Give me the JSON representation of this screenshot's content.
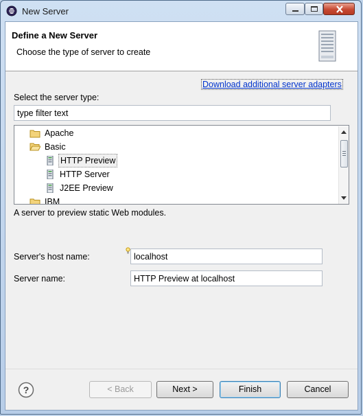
{
  "window": {
    "title": "New Server"
  },
  "header": {
    "title": "Define a New Server",
    "subtitle": "Choose the type of server to create"
  },
  "download_link": "Download additional server adapters",
  "server_type": {
    "label": "Select the server type:",
    "filter_value": "type filter text"
  },
  "tree": {
    "items": [
      {
        "label": "Apache",
        "icon": "folder-icon"
      },
      {
        "label": "Basic",
        "icon": "folder-open-icon"
      },
      {
        "label": "HTTP Preview",
        "icon": "server-icon",
        "selected": true
      },
      {
        "label": "HTTP Server",
        "icon": "server-icon"
      },
      {
        "label": "J2EE Preview",
        "icon": "server-icon"
      },
      {
        "label": "IBM",
        "icon": "folder-icon"
      }
    ]
  },
  "description": "A server to preview static Web modules.",
  "host": {
    "label": "Server's host name:",
    "value": "localhost"
  },
  "name": {
    "label": "Server name:",
    "value": "HTTP Preview at localhost"
  },
  "buttons": {
    "back": "< Back",
    "next": "Next >",
    "finish": "Finish",
    "cancel": "Cancel"
  },
  "colors": {
    "link": "#0033cc",
    "selection_border": "#8a8a8a",
    "finish_border": "#3c7fb1"
  }
}
